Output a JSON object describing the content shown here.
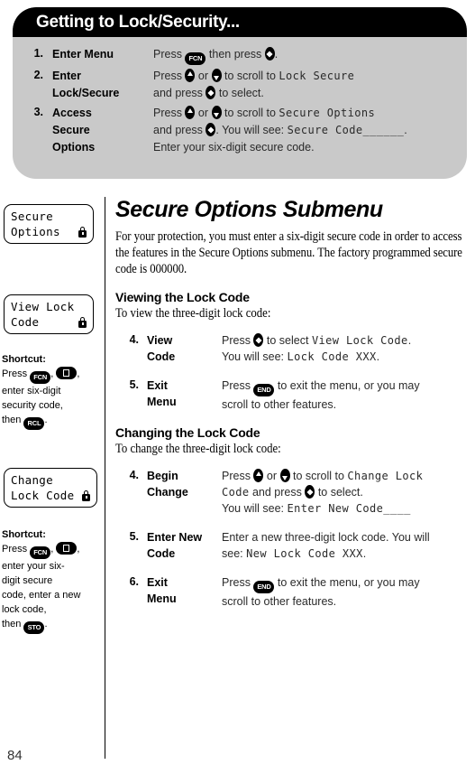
{
  "callout": {
    "title": "Getting to Lock/Security...",
    "steps": [
      {
        "num": "1.",
        "name_lines": [
          "Enter Menu"
        ],
        "desc_lines": [
          [
            {
              "t": "text",
              "v": "Press "
            },
            {
              "t": "key",
              "v": "FCN",
              "style": "wide"
            },
            {
              "t": "text",
              "v": " then press "
            },
            {
              "t": "key",
              "v": "select",
              "style": "round"
            },
            {
              "t": "text",
              "v": "."
            }
          ]
        ]
      },
      {
        "num": "2.",
        "name_lines": [
          "Enter",
          "Lock/Secure"
        ],
        "desc_lines": [
          [
            {
              "t": "text",
              "v": "Press "
            },
            {
              "t": "key",
              "v": "up",
              "style": "round"
            },
            {
              "t": "text",
              "v": " or "
            },
            {
              "t": "key",
              "v": "down",
              "style": "round"
            },
            {
              "t": "text",
              "v": " to scroll to "
            },
            {
              "t": "lcd",
              "v": "Lock Secure"
            }
          ],
          [
            {
              "t": "text",
              "v": "and press "
            },
            {
              "t": "key",
              "v": "select",
              "style": "round"
            },
            {
              "t": "text",
              "v": " to select."
            }
          ]
        ]
      },
      {
        "num": "3.",
        "name_lines": [
          "Access",
          "Secure",
          "Options"
        ],
        "desc_lines": [
          [
            {
              "t": "text",
              "v": "Press "
            },
            {
              "t": "key",
              "v": "up",
              "style": "round"
            },
            {
              "t": "text",
              "v": " or "
            },
            {
              "t": "key",
              "v": "down",
              "style": "round"
            },
            {
              "t": "text",
              "v": " to scroll to "
            },
            {
              "t": "lcd",
              "v": "Secure Options"
            }
          ],
          [
            {
              "t": "text",
              "v": "and press "
            },
            {
              "t": "key",
              "v": "select",
              "style": "round"
            },
            {
              "t": "text",
              "v": ". You will see: "
            },
            {
              "t": "lcd",
              "v": "Secure Code______"
            },
            {
              "t": "text",
              "v": "."
            }
          ],
          [
            {
              "t": "text",
              "v": "Enter your six-digit secure code."
            }
          ]
        ]
      }
    ]
  },
  "sidebar": {
    "lcd_boxes": [
      {
        "lines": [
          "Secure",
          "Options"
        ],
        "lock": true
      },
      {
        "lines": [
          "View Lock",
          "Code"
        ],
        "lock": true
      },
      {
        "lines": [
          "Change",
          "Lock Code"
        ],
        "lock": true
      }
    ],
    "shortcuts": [
      {
        "title": "Shortcut:",
        "lines": [
          [
            {
              "t": "text",
              "v": "Press "
            },
            {
              "t": "key",
              "v": "FCN",
              "style": "wide"
            },
            {
              "t": "text",
              "v": ", "
            },
            {
              "t": "key",
              "v": "0",
              "style": "zero"
            },
            {
              "t": "text",
              "v": ","
            }
          ],
          [
            {
              "t": "text",
              "v": "enter six-digit"
            }
          ],
          [
            {
              "t": "text",
              "v": "security code,"
            }
          ],
          [
            {
              "t": "text",
              "v": "then "
            },
            {
              "t": "key",
              "v": "RCL",
              "style": "wide"
            },
            {
              "t": "text",
              "v": "."
            }
          ]
        ]
      },
      {
        "title": "Shortcut:",
        "lines": [
          [
            {
              "t": "text",
              "v": "Press "
            },
            {
              "t": "key",
              "v": "FCN",
              "style": "wide"
            },
            {
              "t": "text",
              "v": ", "
            },
            {
              "t": "key",
              "v": "0",
              "style": "zero"
            },
            {
              "t": "text",
              "v": ","
            }
          ],
          [
            {
              "t": "text",
              "v": "enter your six-"
            }
          ],
          [
            {
              "t": "text",
              "v": "digit secure"
            }
          ],
          [
            {
              "t": "text",
              "v": "code, enter a new"
            }
          ],
          [
            {
              "t": "text",
              "v": "lock code,"
            }
          ],
          [
            {
              "t": "text",
              "v": "then "
            },
            {
              "t": "key",
              "v": "STO",
              "style": "wide"
            },
            {
              "t": "text",
              "v": "."
            }
          ]
        ]
      }
    ]
  },
  "main": {
    "page_title": "Secure Options Submenu",
    "intro": "For your protection, you must enter a six-digit secure code in order to access the features in the Secure Options submenu. The factory programmed secure code is 000000.",
    "sections": [
      {
        "title": "Viewing the Lock Code",
        "intro": "To view the three-digit lock code:",
        "steps": [
          {
            "num": "4.",
            "name_lines": [
              "View",
              "Code"
            ],
            "desc_lines": [
              [
                {
                  "t": "text",
                  "v": "Press "
                },
                {
                  "t": "key",
                  "v": "select",
                  "style": "round"
                },
                {
                  "t": "text",
                  "v": " to select "
                },
                {
                  "t": "lcd",
                  "v": "View Lock Code"
                },
                {
                  "t": "text",
                  "v": "."
                }
              ],
              [
                {
                  "t": "text",
                  "v": "You will see: "
                },
                {
                  "t": "lcd",
                  "v": "Lock Code XXX"
                },
                {
                  "t": "text",
                  "v": "."
                }
              ]
            ]
          },
          {
            "num": "5.",
            "name_lines": [
              "Exit",
              "Menu"
            ],
            "desc_lines": [
              [
                {
                  "t": "text",
                  "v": "Press "
                },
                {
                  "t": "key",
                  "v": "END",
                  "style": "wide"
                },
                {
                  "t": "text",
                  "v": " to exit the menu, or you may"
                }
              ],
              [
                {
                  "t": "text",
                  "v": "scroll to other features."
                }
              ]
            ]
          }
        ]
      },
      {
        "title": "Changing the Lock Code",
        "intro": "To change the three-digit lock code:",
        "steps": [
          {
            "num": "4.",
            "name_lines": [
              "Begin",
              "Change"
            ],
            "desc_lines": [
              [
                {
                  "t": "text",
                  "v": "Press "
                },
                {
                  "t": "key",
                  "v": "up",
                  "style": "round"
                },
                {
                  "t": "text",
                  "v": " or "
                },
                {
                  "t": "key",
                  "v": "down",
                  "style": "round"
                },
                {
                  "t": "text",
                  "v": " to scroll to "
                },
                {
                  "t": "lcd",
                  "v": "Change Lock"
                }
              ],
              [
                {
                  "t": "lcd",
                  "v": "Code"
                },
                {
                  "t": "text",
                  "v": " and press "
                },
                {
                  "t": "key",
                  "v": "select",
                  "style": "round"
                },
                {
                  "t": "text",
                  "v": " to select."
                }
              ],
              [
                {
                  "t": "text",
                  "v": "You will see: "
                },
                {
                  "t": "lcd",
                  "v": "Enter New Code____"
                }
              ]
            ]
          },
          {
            "num": "5.",
            "name_lines": [
              "Enter New",
              "Code"
            ],
            "desc_lines": [
              [
                {
                  "t": "text",
                  "v": "Enter a new three-digit lock code. You will"
                }
              ],
              [
                {
                  "t": "text",
                  "v": "see: "
                },
                {
                  "t": "lcd",
                  "v": "New Lock Code XXX"
                },
                {
                  "t": "text",
                  "v": "."
                }
              ]
            ]
          },
          {
            "num": "6.",
            "name_lines": [
              "Exit",
              "Menu"
            ],
            "desc_lines": [
              [
                {
                  "t": "text",
                  "v": "Press "
                },
                {
                  "t": "key",
                  "v": "END",
                  "style": "wide"
                },
                {
                  "t": "text",
                  "v": " to exit the menu, or you may"
                }
              ],
              [
                {
                  "t": "text",
                  "v": "scroll to other features."
                }
              ]
            ]
          }
        ]
      }
    ]
  },
  "footer": {
    "page_number": "84"
  }
}
